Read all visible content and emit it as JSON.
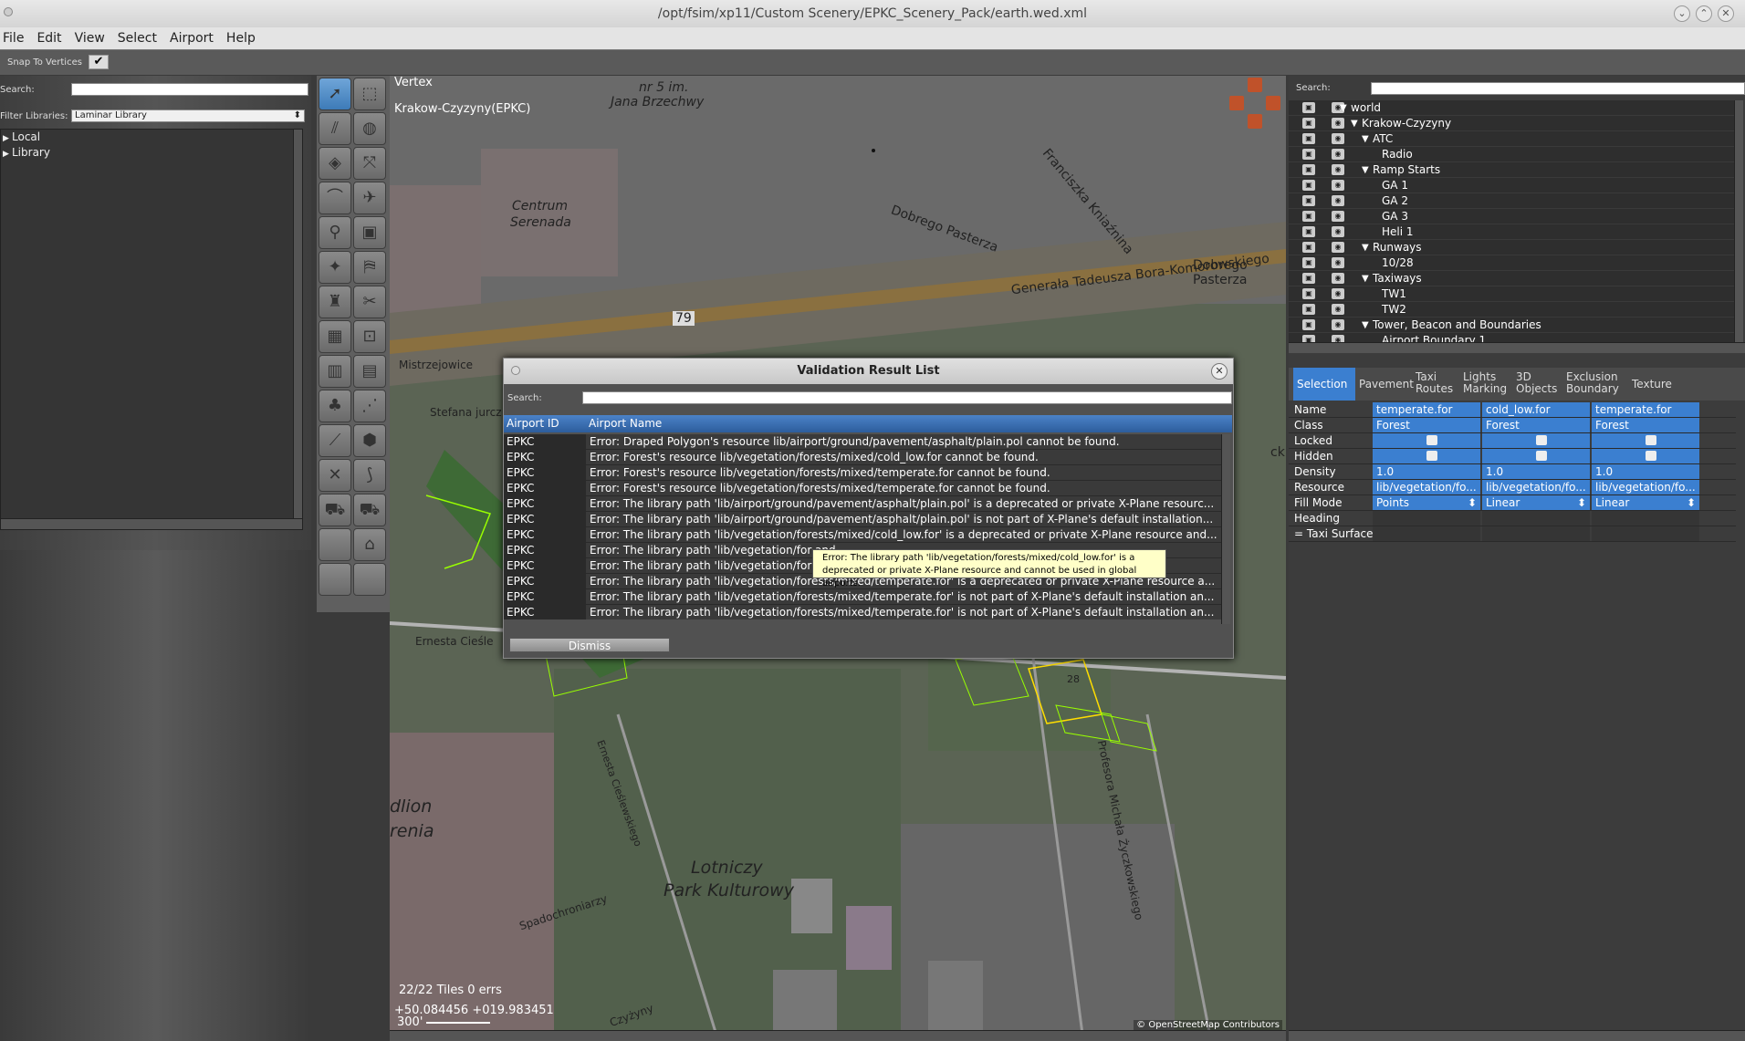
{
  "window": {
    "title": "/opt/fsim/xp11/Custom Scenery/EPKC_Scenery_Pack/earth.wed.xml"
  },
  "menu": [
    "File",
    "Edit",
    "View",
    "Select",
    "Airport",
    "Help"
  ],
  "snap": {
    "label": "Snap To Vertices",
    "checked": "✔"
  },
  "library": {
    "search_label": "Search:",
    "filter_label": "Filter Libraries:",
    "filter_value": "Laminar Library",
    "items": [
      "Local",
      "Library"
    ]
  },
  "map": {
    "tool_name": "Vertex",
    "airport": "Krakow-Czyzyny(EPKC)",
    "tiles": "22/22 Tiles 0 errs",
    "coords": "+50.084456 +019.983451",
    "scale": "300'",
    "copyright": "© OpenStreetMap Contributors",
    "labels": {
      "l1": "nr 5 im.",
      "l2": "Jana Brzechwy",
      "l3": "Centrum",
      "l4": "Serenada",
      "l5": "Dobrego Pasterza",
      "l6": "Franciszka Kniaźnina",
      "l7": "Dobrego Pasterza",
      "l8": "Generała Tadeusza Bora-Komorowskiego",
      "l9": "79",
      "l10": "Mistrzejowice",
      "l11": "Stefana jurcz",
      "l12": "Ernesta Cieśle",
      "l13": "Lotniczy",
      "l14": "Park Kulturowy",
      "l15": "dlion",
      "l16": "renia",
      "l17": "Spadochroniarzy",
      "l18": "Czyżyny",
      "l19": "Profesora Michała Życzkowskiego",
      "l20": "ckie",
      "l21": "28",
      "l22": "Ernesta Cieślewskiego"
    }
  },
  "outline": {
    "search_label": "Search:",
    "rows": [
      {
        "indent": 0,
        "arrow": "▼",
        "label": "world"
      },
      {
        "indent": 1,
        "arrow": "▼",
        "label": "Krakow-Czyzyny"
      },
      {
        "indent": 2,
        "arrow": "▼",
        "label": "ATC"
      },
      {
        "indent": 3,
        "arrow": "",
        "label": "Radio"
      },
      {
        "indent": 2,
        "arrow": "▼",
        "label": "Ramp Starts"
      },
      {
        "indent": 3,
        "arrow": "",
        "label": "GA 1"
      },
      {
        "indent": 3,
        "arrow": "",
        "label": "GA 2"
      },
      {
        "indent": 3,
        "arrow": "",
        "label": "GA 3"
      },
      {
        "indent": 3,
        "arrow": "",
        "label": "Heli 1"
      },
      {
        "indent": 2,
        "arrow": "▼",
        "label": "Runways"
      },
      {
        "indent": 3,
        "arrow": "",
        "label": "10/28"
      },
      {
        "indent": 2,
        "arrow": "▼",
        "label": "Taxiways"
      },
      {
        "indent": 3,
        "arrow": "",
        "label": "TW1"
      },
      {
        "indent": 3,
        "arrow": "",
        "label": "TW2"
      },
      {
        "indent": 2,
        "arrow": "▼",
        "label": "Tower, Beacon and Boundaries"
      },
      {
        "indent": 3,
        "arrow": "",
        "label": "Airport Boundary 1"
      }
    ]
  },
  "tabs": [
    "Selection",
    "Pavement",
    "Taxi Routes",
    "Lights Marking",
    "3D Objects",
    "Exclusion Boundary",
    "Texture"
  ],
  "props": {
    "keys": [
      "Name",
      "Class",
      "Locked",
      "Hidden",
      "Density",
      "Resource",
      "Fill Mode",
      "Heading",
      "= Taxi Surface"
    ],
    "cols": [
      {
        "name": "temperate.for",
        "class": "Forest",
        "density": "1.0",
        "resource": "lib/vegetation/fo...",
        "fill": "Points"
      },
      {
        "name": "cold_low.for",
        "class": "Forest",
        "density": "1.0",
        "resource": "lib/vegetation/fo...",
        "fill": "Linear"
      },
      {
        "name": "temperate.for",
        "class": "Forest",
        "density": "1.0",
        "resource": "lib/vegetation/fo...",
        "fill": "Linear"
      }
    ]
  },
  "dialog": {
    "title": "Validation Result List",
    "search_label": "Search:",
    "col_id": "Airport ID",
    "col_name": "Airport Name",
    "dismiss": "Dismiss",
    "rows": [
      {
        "id": "EPKC",
        "msg": "Error: Draped Polygon's resource lib/airport/ground/pavement/asphalt/plain.pol cannot be found."
      },
      {
        "id": "EPKC",
        "msg": "Error: Forest's resource lib/vegetation/forests/mixed/cold_low.for cannot be found."
      },
      {
        "id": "EPKC",
        "msg": "Error: Forest's resource lib/vegetation/forests/mixed/temperate.for cannot be found."
      },
      {
        "id": "EPKC",
        "msg": "Error: Forest's resource lib/vegetation/forests/mixed/temperate.for cannot be found."
      },
      {
        "id": "EPKC",
        "msg": "Error: The library path 'lib/airport/ground/pavement/asphalt/plain.pol' is a deprecated or private X-Plane resourc..."
      },
      {
        "id": "EPKC",
        "msg": "Error: The library path 'lib/airport/ground/pavement/asphalt/plain.pol' is not part of X-Plane's default installation..."
      },
      {
        "id": "EPKC",
        "msg": "Error: The library path 'lib/vegetation/forests/mixed/cold_low.for' is a deprecated or private X-Plane resource and..."
      },
      {
        "id": "EPKC",
        "msg": "Error: The library path 'lib/vegetation/for                                                                              and ..."
      },
      {
        "id": "EPKC",
        "msg": "Error: The library path 'lib/vegetation/for                                                                              urce a..."
      },
      {
        "id": "EPKC",
        "msg": "Error: The library path 'lib/vegetation/forests/mixed/temperate.for' is a deprecated or private X-Plane resource a..."
      },
      {
        "id": "EPKC",
        "msg": "Error: The library path 'lib/vegetation/forests/mixed/temperate.for' is not part of X-Plane's default installation an..."
      },
      {
        "id": "EPKC",
        "msg": "Error: The library path 'lib/vegetation/forests/mixed/temperate.for' is not part of X-Plane's default installation an..."
      }
    ],
    "tooltip": "Error: The library path 'lib/vegetation/forests/mixed/cold_low.for' is a deprecated or private X-Plane resource and cannot be used in global airports."
  }
}
